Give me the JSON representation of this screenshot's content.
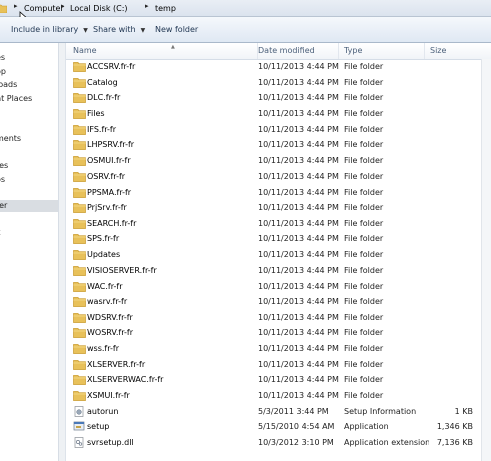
{
  "address": {
    "crumbs": [
      "Computer",
      "Local Disk (C:)",
      "temp"
    ]
  },
  "toolbar": {
    "include_label": "Include in library",
    "share_label": "Share with",
    "newfolder_label": "New folder"
  },
  "nav": {
    "items": [
      "es",
      "op",
      "loads",
      "nt Places",
      "s",
      "ments",
      "",
      "res",
      "os",
      "ter",
      "k"
    ]
  },
  "columns": {
    "name": "Name",
    "date": "Date modified",
    "type": "Type",
    "size": "Size"
  },
  "files": [
    {
      "name": "ACCSRV.fr-fr",
      "date": "10/11/2013 4:44 PM",
      "type": "File folder",
      "size": "",
      "icon": "folder-icon"
    },
    {
      "name": "Catalog",
      "date": "10/11/2013 4:44 PM",
      "type": "File folder",
      "size": "",
      "icon": "folder-icon"
    },
    {
      "name": "DLC.fr-fr",
      "date": "10/11/2013 4:44 PM",
      "type": "File folder",
      "size": "",
      "icon": "folder-icon"
    },
    {
      "name": "Files",
      "date": "10/11/2013 4:44 PM",
      "type": "File folder",
      "size": "",
      "icon": "folder-icon"
    },
    {
      "name": "IFS.fr-fr",
      "date": "10/11/2013 4:44 PM",
      "type": "File folder",
      "size": "",
      "icon": "folder-icon"
    },
    {
      "name": "LHPSRV.fr-fr",
      "date": "10/11/2013 4:44 PM",
      "type": "File folder",
      "size": "",
      "icon": "folder-icon"
    },
    {
      "name": "OSMUI.fr-fr",
      "date": "10/11/2013 4:44 PM",
      "type": "File folder",
      "size": "",
      "icon": "folder-icon"
    },
    {
      "name": "OSRV.fr-fr",
      "date": "10/11/2013 4:44 PM",
      "type": "File folder",
      "size": "",
      "icon": "folder-icon"
    },
    {
      "name": "PPSMA.fr-fr",
      "date": "10/11/2013 4:44 PM",
      "type": "File folder",
      "size": "",
      "icon": "folder-icon"
    },
    {
      "name": "PrjSrv.fr-fr",
      "date": "10/11/2013 4:44 PM",
      "type": "File folder",
      "size": "",
      "icon": "folder-icon"
    },
    {
      "name": "SEARCH.fr-fr",
      "date": "10/11/2013 4:44 PM",
      "type": "File folder",
      "size": "",
      "icon": "folder-icon"
    },
    {
      "name": "SPS.fr-fr",
      "date": "10/11/2013 4:44 PM",
      "type": "File folder",
      "size": "",
      "icon": "folder-icon"
    },
    {
      "name": "Updates",
      "date": "10/11/2013 4:44 PM",
      "type": "File folder",
      "size": "",
      "icon": "folder-icon"
    },
    {
      "name": "VISIOSERVER.fr-fr",
      "date": "10/11/2013 4:44 PM",
      "type": "File folder",
      "size": "",
      "icon": "folder-icon"
    },
    {
      "name": "WAC.fr-fr",
      "date": "10/11/2013 4:44 PM",
      "type": "File folder",
      "size": "",
      "icon": "folder-icon"
    },
    {
      "name": "wasrv.fr-fr",
      "date": "10/11/2013 4:44 PM",
      "type": "File folder",
      "size": "",
      "icon": "folder-icon"
    },
    {
      "name": "WDSRV.fr-fr",
      "date": "10/11/2013 4:44 PM",
      "type": "File folder",
      "size": "",
      "icon": "folder-icon"
    },
    {
      "name": "WOSRV.fr-fr",
      "date": "10/11/2013 4:44 PM",
      "type": "File folder",
      "size": "",
      "icon": "folder-icon"
    },
    {
      "name": "wss.fr-fr",
      "date": "10/11/2013 4:44 PM",
      "type": "File folder",
      "size": "",
      "icon": "folder-icon"
    },
    {
      "name": "XLSERVER.fr-fr",
      "date": "10/11/2013 4:44 PM",
      "type": "File folder",
      "size": "",
      "icon": "folder-icon"
    },
    {
      "name": "XLSERVERWAC.fr-fr",
      "date": "10/11/2013 4:44 PM",
      "type": "File folder",
      "size": "",
      "icon": "folder-icon"
    },
    {
      "name": "XSMUI.fr-fr",
      "date": "10/11/2013 4:44 PM",
      "type": "File folder",
      "size": "",
      "icon": "folder-icon"
    },
    {
      "name": "autorun",
      "date": "5/3/2011 3:44 PM",
      "type": "Setup Information",
      "size": "1 KB",
      "icon": "setup-info-icon"
    },
    {
      "name": "setup",
      "date": "5/15/2010 4:54 AM",
      "type": "Application",
      "size": "1,346 KB",
      "icon": "application-icon"
    },
    {
      "name": "svrsetup.dll",
      "date": "10/3/2012 3:10 PM",
      "type": "Application extension",
      "size": "7,136 KB",
      "icon": "dll-icon"
    }
  ],
  "colors": {
    "folder": "#e8c15a",
    "folder_dark": "#c99a2c",
    "toolbar_text": "#1e3450",
    "header_text": "#4c607a"
  }
}
